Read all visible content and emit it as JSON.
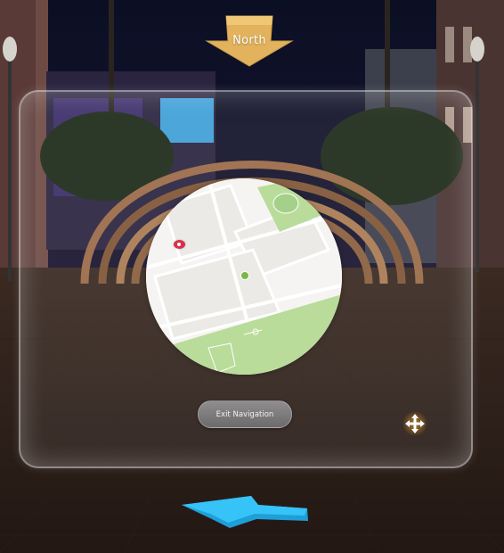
{
  "compass": {
    "label": "North",
    "icon": "north-arrow-icon"
  },
  "map": {
    "markers": [
      {
        "icon": "location-pin-icon",
        "color": "#d8304a"
      },
      {
        "icon": "user-location-icon",
        "color": "#7ab648"
      }
    ],
    "colors": {
      "land": "#f6f4f2",
      "park": "#b9dc9a",
      "park_dark": "#a5d08a",
      "road": "#ffffff"
    }
  },
  "controls": {
    "exit_label": "Exit Navigation",
    "move_icon": "move-arrows-icon",
    "direction_icon": "direction-arrow-icon",
    "direction_color": "#2bb8f2"
  },
  "scene": {
    "accent_gold": "#e2b25c",
    "glass_border": "#ffffff"
  }
}
